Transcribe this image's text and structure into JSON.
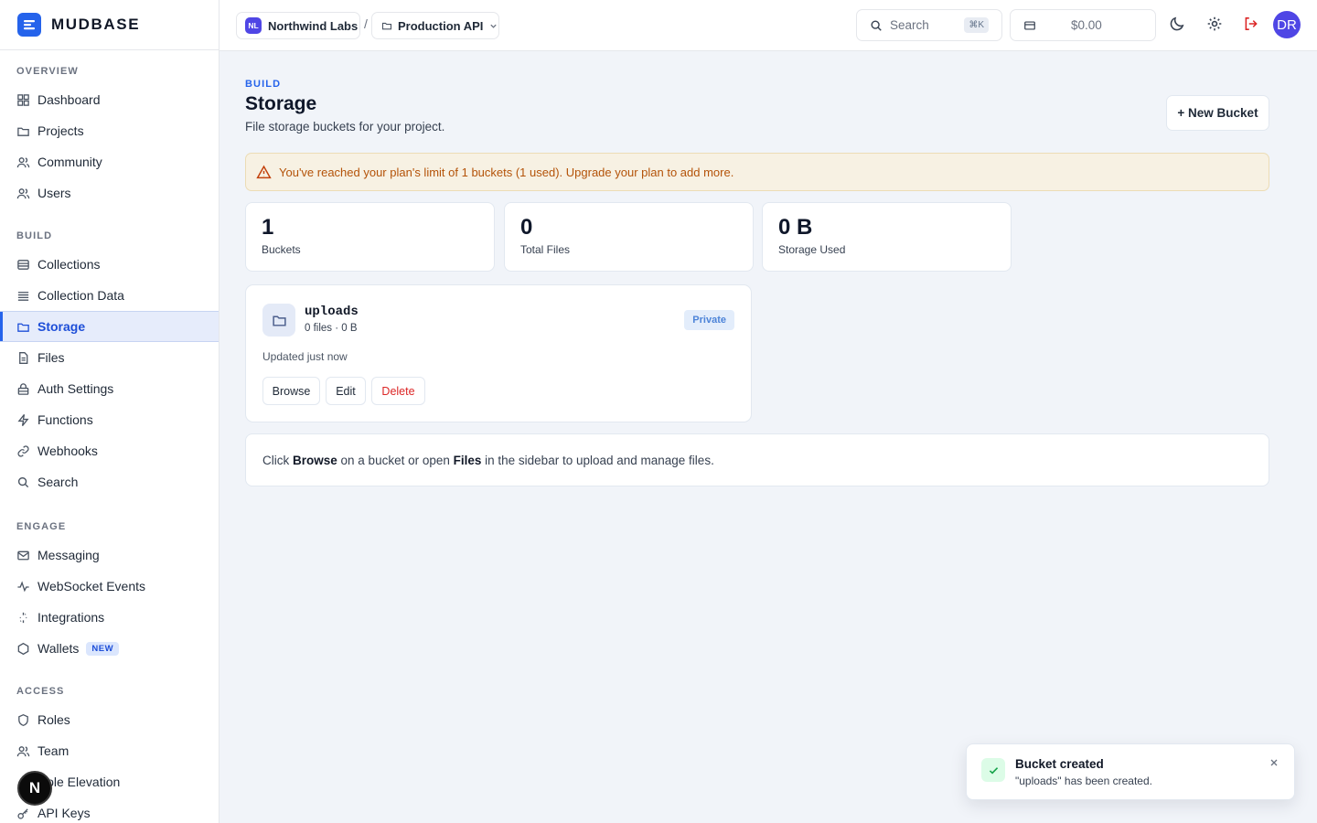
{
  "brand": {
    "name": "MUDBASE",
    "accent": "#2563eb"
  },
  "sidebar": {
    "sections": [
      {
        "title": "OVERVIEW",
        "items": [
          {
            "label": "Dashboard",
            "icon": "grid-icon"
          },
          {
            "label": "Projects",
            "icon": "folder-icon"
          },
          {
            "label": "Community",
            "icon": "users-icon"
          },
          {
            "label": "Users",
            "icon": "users-icon"
          }
        ]
      },
      {
        "title": "BUILD",
        "items": [
          {
            "label": "Collections",
            "icon": "database-icon"
          },
          {
            "label": "Collection Data",
            "icon": "rows-icon"
          },
          {
            "label": "Storage",
            "icon": "folder-icon",
            "active": true
          },
          {
            "label": "Files",
            "icon": "file-icon"
          },
          {
            "label": "Auth Settings",
            "icon": "lock-icon"
          },
          {
            "label": "Functions",
            "icon": "bolt-icon"
          },
          {
            "label": "Webhooks",
            "icon": "link-icon"
          },
          {
            "label": "Search",
            "icon": "search-icon"
          }
        ]
      },
      {
        "title": "ENGAGE",
        "items": [
          {
            "label": "Messaging",
            "icon": "mail-icon"
          },
          {
            "label": "WebSocket Events",
            "icon": "activity-icon"
          },
          {
            "label": "Integrations",
            "icon": "sparkle-icon"
          },
          {
            "label": "Wallets",
            "icon": "hexagon-icon",
            "badge": "NEW"
          }
        ]
      },
      {
        "title": "ACCESS",
        "items": [
          {
            "label": "Roles",
            "icon": "shield-icon"
          },
          {
            "label": "Team",
            "icon": "users-icon"
          },
          {
            "label": "Role Elevation",
            "icon": "arrow-up-icon"
          },
          {
            "label": "API Keys",
            "icon": "key-icon"
          }
        ]
      }
    ],
    "floating_badge": "N"
  },
  "topbar": {
    "org": {
      "initials": "NL",
      "name": "Northwind Labs"
    },
    "separator": "/",
    "project": {
      "name": "Production API"
    },
    "search": {
      "placeholder": "Search",
      "shortcut": "⌘K"
    },
    "credits": "$0.00",
    "user_initials": "DR"
  },
  "page": {
    "eyebrow": "BUILD",
    "title": "Storage",
    "subtitle": "File storage buckets for your project.",
    "new_button": "+ New Bucket",
    "alert": "You've reached your plan's limit of 1 buckets (1 used). Upgrade your plan to add more.",
    "stats": [
      {
        "value": "1",
        "label": "Buckets"
      },
      {
        "value": "0",
        "label": "Total Files"
      },
      {
        "value": "0 B",
        "label": "Storage Used"
      }
    ],
    "bucket": {
      "name": "uploads",
      "meta": "0 files · 0 B",
      "visibility": "Private",
      "updated": "Updated just now",
      "actions": {
        "browse": "Browse",
        "edit": "Edit",
        "delete": "Delete"
      }
    },
    "info": {
      "pre": "Click ",
      "browse": "Browse",
      "mid": " on a bucket or open ",
      "files": "Files",
      "post": " in the sidebar to upload and manage files."
    }
  },
  "toast": {
    "title": "Bucket created",
    "message": "\"uploads\" has been created."
  }
}
